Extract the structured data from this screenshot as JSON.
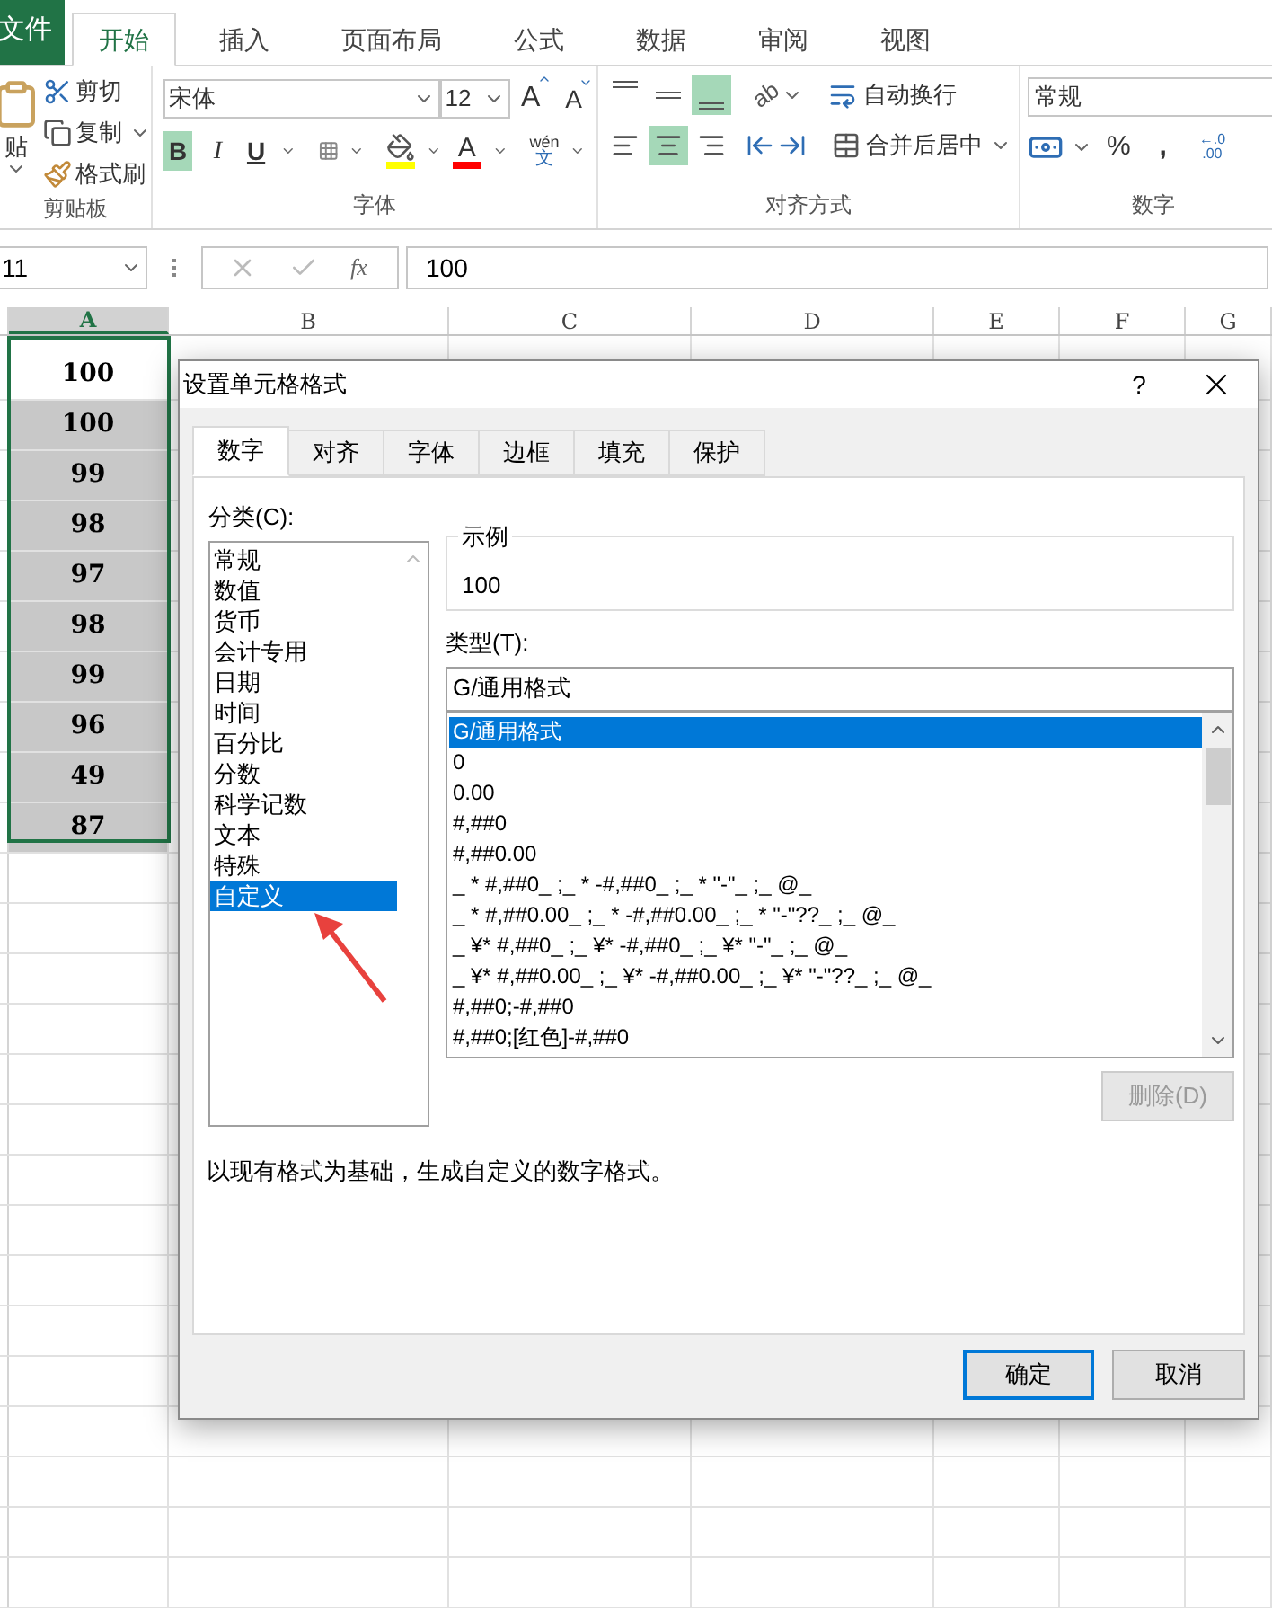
{
  "ribbon": {
    "tabs": [
      {
        "label": "文件",
        "kind": "file",
        "selected": false
      },
      {
        "label": "开始",
        "kind": "tab",
        "selected": true
      },
      {
        "label": "插入",
        "kind": "tab",
        "selected": false
      },
      {
        "label": "页面布局",
        "kind": "tab",
        "selected": false
      },
      {
        "label": "公式",
        "kind": "tab",
        "selected": false
      },
      {
        "label": "数据",
        "kind": "tab",
        "selected": false
      },
      {
        "label": "审阅",
        "kind": "tab",
        "selected": false
      },
      {
        "label": "视图",
        "kind": "tab",
        "selected": false
      }
    ],
    "clipboard": {
      "paste": "贴",
      "cut": "剪切",
      "copy": "复制",
      "format_painter": "格式刷",
      "label": "剪贴板"
    },
    "font": {
      "name": "宋体",
      "size": "12",
      "grow": "A",
      "shrink": "A",
      "bold": {
        "label": "B",
        "selected": true
      },
      "italic": {
        "label": "I",
        "selected": false
      },
      "underline": {
        "label": "U",
        "selected": false
      },
      "font_color": "A",
      "phonetic_top": "wén",
      "phonetic_bottom": "文",
      "label": "字体"
    },
    "alignment": {
      "vertical": [
        {
          "kind": "top",
          "selected": false
        },
        {
          "kind": "middle",
          "selected": false
        },
        {
          "kind": "bottom",
          "selected": true
        }
      ],
      "horizontal": [
        {
          "kind": "left",
          "selected": false
        },
        {
          "kind": "center",
          "selected": true
        },
        {
          "kind": "right",
          "selected": false
        }
      ],
      "orientation": "ab",
      "wrap": "自动换行",
      "merge": "合并后居中",
      "label": "对齐方式"
    },
    "number": {
      "format": "常规",
      "percent": "%",
      "comma": ",",
      "inc_top": "←.0",
      "inc_bottom": ".00",
      "label": "数字"
    }
  },
  "formula_bar": {
    "name_box": "11",
    "function": "fx",
    "value": "100"
  },
  "sheet": {
    "columns": [
      {
        "label": "A",
        "selected": true
      },
      {
        "label": "B",
        "selected": false
      },
      {
        "label": "C",
        "selected": false
      },
      {
        "label": "D",
        "selected": false
      },
      {
        "label": "E",
        "selected": false
      },
      {
        "label": "F",
        "selected": false
      },
      {
        "label": "G",
        "selected": false
      }
    ],
    "cells": [
      "100",
      "100",
      "99",
      "98",
      "97",
      "98",
      "99",
      "96",
      "49",
      "87"
    ]
  },
  "dialog": {
    "title": "设置单元格格式",
    "help": "?",
    "tabs": [
      {
        "label": "数字",
        "selected": true
      },
      {
        "label": "对齐",
        "selected": false
      },
      {
        "label": "字体",
        "selected": false
      },
      {
        "label": "边框",
        "selected": false
      },
      {
        "label": "填充",
        "selected": false
      },
      {
        "label": "保护",
        "selected": false
      }
    ],
    "category_label": "分类(C):",
    "categories": [
      {
        "label": "常规",
        "selected": false
      },
      {
        "label": "数值",
        "selected": false
      },
      {
        "label": "货币",
        "selected": false
      },
      {
        "label": "会计专用",
        "selected": false
      },
      {
        "label": "日期",
        "selected": false
      },
      {
        "label": "时间",
        "selected": false
      },
      {
        "label": "百分比",
        "selected": false
      },
      {
        "label": "分数",
        "selected": false
      },
      {
        "label": "科学记数",
        "selected": false
      },
      {
        "label": "文本",
        "selected": false
      },
      {
        "label": "特殊",
        "selected": false
      },
      {
        "label": "自定义",
        "selected": true
      }
    ],
    "sample_label": "示例",
    "sample_value": "100",
    "type_label": "类型(T):",
    "type_value": "G/通用格式",
    "types": [
      {
        "label": "G/通用格式",
        "selected": true
      },
      {
        "label": "0",
        "selected": false
      },
      {
        "label": "0.00",
        "selected": false
      },
      {
        "label": "#,##0",
        "selected": false
      },
      {
        "label": "#,##0.00",
        "selected": false
      },
      {
        "label": "_ * #,##0_ ;_ * -#,##0_ ;_ * \"-\"_ ;_ @_",
        "selected": false
      },
      {
        "label": "_ * #,##0.00_ ;_ * -#,##0.00_ ;_ * \"-\"??_ ;_ @_",
        "selected": false
      },
      {
        "label": "_ ¥* #,##0_ ;_ ¥* -#,##0_ ;_ ¥* \"-\"_ ;_ @_",
        "selected": false
      },
      {
        "label": "_ ¥* #,##0.00_ ;_ ¥* -#,##0.00_ ;_ ¥* \"-\"??_ ;_ @_",
        "selected": false
      },
      {
        "label": "#,##0;-#,##0",
        "selected": false
      },
      {
        "label": "#,##0;[红色]-#,##0",
        "selected": false
      }
    ],
    "delete": {
      "label": "删除(D)",
      "disabled": true
    },
    "description": "以现有格式为基础，生成自定义的数字格式。",
    "ok": "确定",
    "cancel": "取消"
  }
}
